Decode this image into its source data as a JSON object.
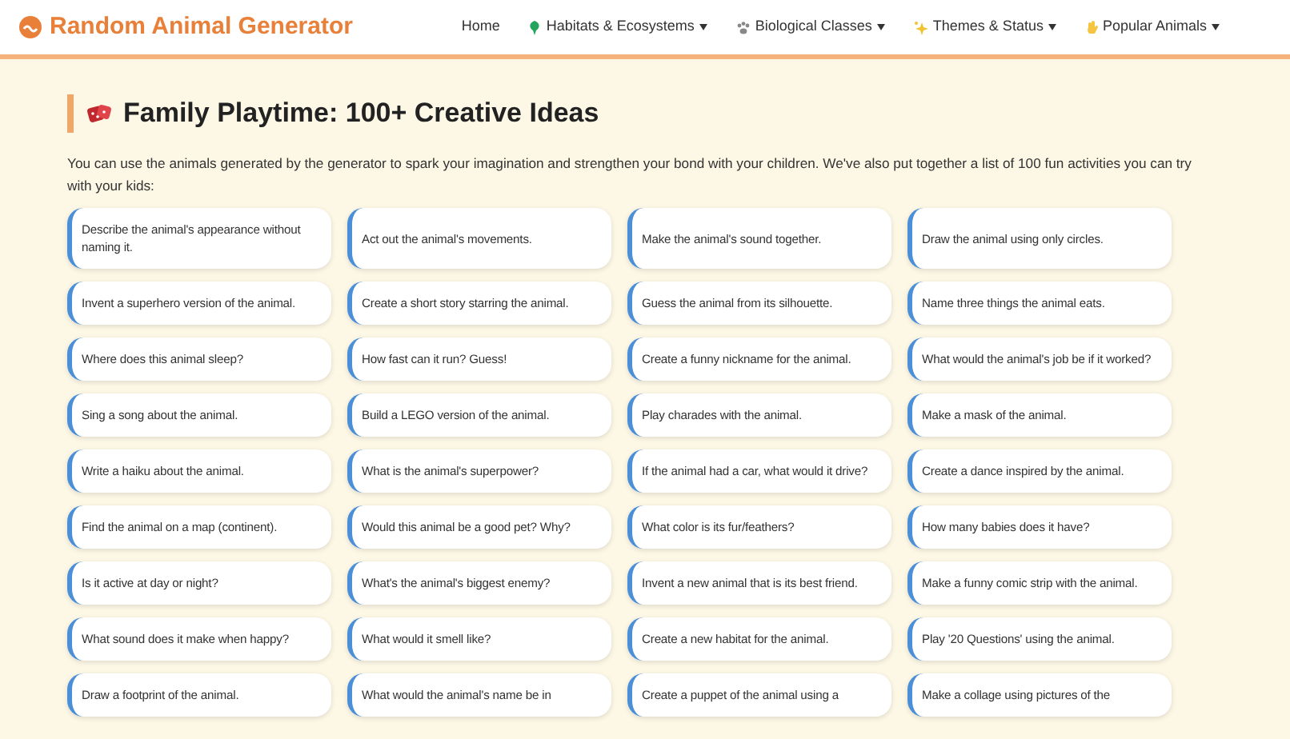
{
  "header": {
    "brand": "Random Animal Generator",
    "nav": [
      {
        "label": "Home",
        "has_menu": false
      },
      {
        "label": "Habitats & Ecosystems",
        "has_menu": true
      },
      {
        "label": "Biological Classes",
        "has_menu": true
      },
      {
        "label": "Themes & Status",
        "has_menu": true
      },
      {
        "label": "Popular Animals",
        "has_menu": true
      }
    ]
  },
  "section": {
    "title": "Family Playtime: 100+ Creative Ideas",
    "intro": "You can use the animals generated by the generator to spark your imagination and strengthen your bond with your children. We've also put together a list of 100 fun activities you can try with your kids:",
    "ideas": [
      "Describe the animal's appearance without naming it.",
      "Act out the animal's movements.",
      "Make the animal's sound together.",
      "Draw the animal using only circles.",
      "Invent a superhero version of the animal.",
      "Create a short story starring the animal.",
      "Guess the animal from its silhouette.",
      "Name three things the animal eats.",
      "Where does this animal sleep?",
      "How fast can it run? Guess!",
      "Create a funny nickname for the animal.",
      "What would the animal's job be if it worked?",
      "Sing a song about the animal.",
      "Build a LEGO version of the animal.",
      "Play charades with the animal.",
      "Make a mask of the animal.",
      "Write a haiku about the animal.",
      "What is the animal's superpower?",
      "If the animal had a car, what would it drive?",
      "Create a dance inspired by the animal.",
      "Find the animal on a map (continent).",
      "Would this animal be a good pet? Why?",
      "What color is its fur/feathers?",
      "How many babies does it have?",
      "Is it active at day or night?",
      "What's the animal's biggest enemy?",
      "Invent a new animal that is its best friend.",
      "Make a funny comic strip with the animal.",
      "What sound does it make when happy?",
      "What would it smell like?",
      "Create a new habitat for the animal.",
      "Play '20 Questions' using the animal.",
      "Draw a footprint of the animal.",
      "What would the animal's name be in",
      "Create a puppet of the animal using a",
      "Make a collage using pictures of the"
    ]
  }
}
